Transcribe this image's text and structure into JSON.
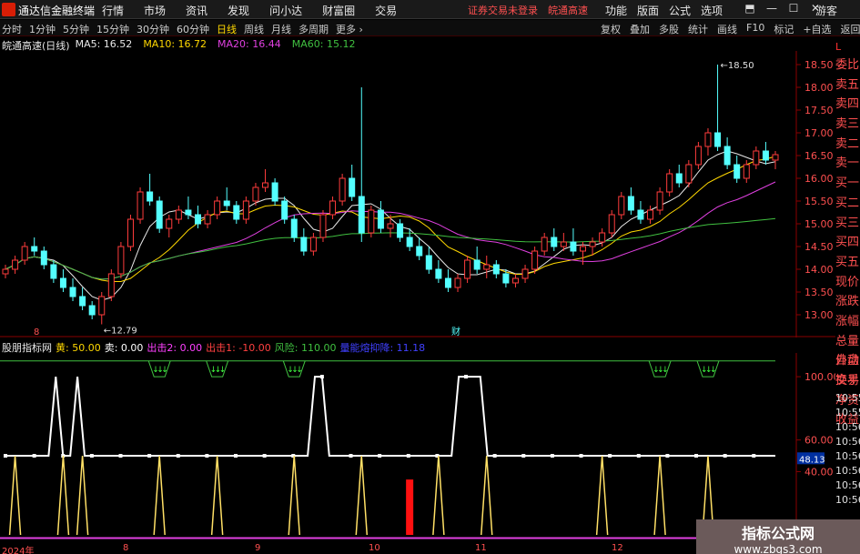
{
  "app": {
    "name": "通达信金融终端",
    "status_text": "证券交易未登录　皖通高速",
    "guest": "游客"
  },
  "menu": [
    "行情",
    "市场",
    "资讯",
    "发现",
    "问小达",
    "财富圈",
    "交易"
  ],
  "right_menu": [
    "功能",
    "版面",
    "公式",
    "选项"
  ],
  "window_buttons": [
    "⬒",
    "—",
    "☐",
    "✕"
  ],
  "periods": [
    "分时",
    "1分钟",
    "5分钟",
    "15分钟",
    "30分钟",
    "60分钟",
    "日线",
    "周线",
    "月线",
    "多周期",
    "更多 ›"
  ],
  "active_period": "日线",
  "tools": [
    "复权",
    "叠加",
    "多股",
    "统计",
    "画线",
    "F10",
    "标记",
    "+自选",
    "返回"
  ],
  "stock": {
    "name": "皖通高速(日线)"
  },
  "ma": [
    {
      "label": "MA5: 16.52",
      "color": "#e8e8e8"
    },
    {
      "label": "MA10: 16.72",
      "color": "#ffd800"
    },
    {
      "label": "MA20: 16.44",
      "color": "#e040e0"
    },
    {
      "label": "MA60: 15.12",
      "color": "#40c040"
    }
  ],
  "price_axis": [
    "18.50",
    "18.00",
    "17.50",
    "17.00",
    "16.50",
    "16.00",
    "15.50",
    "15.00",
    "14.50",
    "14.00",
    "13.50",
    "13.00"
  ],
  "annotations": {
    "high": "18.50",
    "low": "12.79",
    "marker8": "8",
    "marker_fin": "财"
  },
  "sidebar": {
    "header": "L",
    "items": [
      "委比",
      "卖五",
      "卖四",
      "卖三",
      "卖二",
      "卖一",
      "买一",
      "买二",
      "买三",
      "买四",
      "买五",
      "现价",
      "涨跌",
      "涨幅",
      "总量",
      "外盘",
      "换手",
      "净资",
      "收益"
    ]
  },
  "sidebar2": {
    "items": [
      "自动",
      "交易"
    ],
    "times": [
      "10:55",
      "10:55",
      "10:56",
      "10:56",
      "10:56",
      "10:56",
      "10:56",
      "10:56"
    ]
  },
  "indicator": {
    "title": "股朋指标网",
    "values": [
      {
        "label": "黄: 50.00",
        "color": "#ffd800"
      },
      {
        "label": "卖: 0.00",
        "color": "#ffffff"
      },
      {
        "label": "出击2: 0.00",
        "color": "#ff40ff"
      },
      {
        "label": "出击1: -10.00",
        "color": "#ff4040"
      },
      {
        "label": "风险: 110.00",
        "color": "#40c040"
      },
      {
        "label": "量能熔抑降: 11.18",
        "color": "#4040ff"
      }
    ],
    "axis": [
      "100.00",
      "60.00",
      "40.00"
    ],
    "current": "48.13"
  },
  "dates": [
    "2024年",
    "8",
    "9",
    "10",
    "11",
    "12"
  ],
  "watermark": {
    "line1": "指标公式网",
    "line2": "www.zbgs3.com"
  },
  "chart_data": {
    "type": "candlestick",
    "ylim": [
      12.6,
      18.8
    ],
    "candles": [
      [
        13.9,
        14.1,
        13.8,
        14.0
      ],
      [
        14.0,
        14.3,
        13.9,
        14.2
      ],
      [
        14.2,
        14.6,
        14.1,
        14.5
      ],
      [
        14.5,
        14.7,
        14.3,
        14.4
      ],
      [
        14.4,
        14.5,
        14.0,
        14.1
      ],
      [
        14.1,
        14.2,
        13.7,
        13.8
      ],
      [
        13.8,
        14.0,
        13.5,
        13.6
      ],
      [
        13.6,
        13.8,
        13.3,
        13.4
      ],
      [
        13.4,
        13.6,
        13.1,
        13.2
      ],
      [
        13.2,
        13.3,
        12.9,
        13.0
      ],
      [
        13.0,
        13.5,
        12.79,
        13.4
      ],
      [
        13.4,
        14.0,
        13.3,
        13.9
      ],
      [
        13.9,
        14.6,
        13.8,
        14.5
      ],
      [
        14.5,
        15.2,
        14.4,
        15.1
      ],
      [
        15.1,
        15.8,
        15.0,
        15.7
      ],
      [
        15.7,
        16.1,
        15.4,
        15.5
      ],
      [
        15.5,
        15.6,
        14.8,
        14.9
      ],
      [
        14.9,
        15.2,
        14.7,
        15.1
      ],
      [
        15.1,
        15.4,
        15.0,
        15.3
      ],
      [
        15.3,
        15.6,
        15.1,
        15.2
      ],
      [
        15.2,
        15.4,
        14.9,
        15.0
      ],
      [
        15.0,
        15.3,
        14.9,
        15.2
      ],
      [
        15.2,
        15.6,
        15.1,
        15.5
      ],
      [
        15.5,
        15.8,
        15.3,
        15.4
      ],
      [
        15.4,
        15.5,
        15.0,
        15.1
      ],
      [
        15.1,
        15.6,
        15.0,
        15.5
      ],
      [
        15.5,
        15.9,
        15.4,
        15.8
      ],
      [
        15.8,
        16.2,
        15.7,
        15.9
      ],
      [
        15.9,
        16.0,
        15.4,
        15.5
      ],
      [
        15.5,
        15.6,
        15.0,
        15.1
      ],
      [
        15.1,
        15.2,
        14.6,
        14.7
      ],
      [
        14.7,
        14.9,
        14.3,
        14.4
      ],
      [
        14.4,
        14.8,
        14.3,
        14.7
      ],
      [
        14.7,
        15.3,
        14.6,
        15.2
      ],
      [
        15.2,
        15.6,
        15.1,
        15.5
      ],
      [
        15.5,
        16.1,
        15.4,
        16.0
      ],
      [
        16.0,
        16.3,
        15.5,
        15.6
      ],
      [
        15.6,
        18.0,
        14.6,
        14.8
      ],
      [
        14.8,
        15.4,
        14.7,
        15.3
      ],
      [
        15.3,
        15.5,
        14.8,
        14.9
      ],
      [
        14.9,
        15.2,
        14.7,
        15.0
      ],
      [
        15.0,
        15.1,
        14.6,
        14.7
      ],
      [
        14.7,
        14.9,
        14.4,
        14.5
      ],
      [
        14.5,
        14.7,
        14.2,
        14.3
      ],
      [
        14.3,
        14.5,
        13.9,
        14.0
      ],
      [
        14.0,
        14.2,
        13.7,
        13.8
      ],
      [
        13.8,
        14.0,
        13.5,
        13.6
      ],
      [
        13.6,
        13.9,
        13.5,
        13.8
      ],
      [
        13.8,
        14.3,
        13.7,
        14.2
      ],
      [
        14.2,
        14.5,
        13.9,
        14.0
      ],
      [
        14.0,
        14.3,
        13.8,
        14.1
      ],
      [
        14.1,
        14.2,
        13.8,
        13.9
      ],
      [
        13.9,
        14.0,
        13.6,
        13.7
      ],
      [
        13.7,
        13.9,
        13.6,
        13.8
      ],
      [
        13.8,
        14.1,
        13.7,
        14.0
      ],
      [
        14.0,
        14.5,
        13.9,
        14.4
      ],
      [
        14.4,
        14.8,
        14.3,
        14.7
      ],
      [
        14.7,
        14.9,
        14.4,
        14.5
      ],
      [
        14.5,
        14.8,
        14.4,
        14.6
      ],
      [
        14.6,
        14.9,
        14.3,
        14.4
      ],
      [
        14.4,
        14.6,
        14.1,
        14.5
      ],
      [
        14.5,
        14.7,
        14.3,
        14.6
      ],
      [
        14.6,
        14.9,
        14.5,
        14.8
      ],
      [
        14.8,
        15.3,
        14.7,
        15.2
      ],
      [
        15.2,
        15.7,
        15.1,
        15.6
      ],
      [
        15.6,
        15.8,
        15.2,
        15.3
      ],
      [
        15.3,
        15.5,
        15.0,
        15.1
      ],
      [
        15.1,
        15.4,
        15.0,
        15.3
      ],
      [
        15.3,
        15.8,
        15.2,
        15.7
      ],
      [
        15.7,
        16.2,
        15.6,
        16.1
      ],
      [
        16.1,
        16.3,
        15.8,
        15.9
      ],
      [
        15.9,
        16.4,
        15.8,
        16.3
      ],
      [
        16.3,
        16.8,
        16.2,
        16.7
      ],
      [
        16.7,
        17.1,
        16.5,
        17.0
      ],
      [
        17.0,
        18.5,
        16.6,
        16.7
      ],
      [
        16.7,
        16.9,
        16.2,
        16.3
      ],
      [
        16.3,
        16.5,
        15.9,
        16.0
      ],
      [
        16.0,
        16.4,
        15.9,
        16.3
      ],
      [
        16.3,
        16.7,
        16.2,
        16.6
      ],
      [
        16.6,
        16.8,
        16.3,
        16.4
      ],
      [
        16.4,
        16.6,
        16.2,
        16.52
      ]
    ],
    "ma5_color": "#e8e8e8",
    "ma10_color": "#ffd800",
    "ma20_color": "#e040e0",
    "ma60_color": "#40c040",
    "indicator_ylim": [
      0,
      115
    ],
    "white_line": [
      50,
      50,
      50,
      50,
      50,
      50,
      50,
      100,
      50,
      50,
      100,
      50,
      50,
      50,
      50,
      50,
      50,
      50,
      50,
      50,
      50,
      50,
      50,
      50,
      50,
      50,
      50,
      50,
      50,
      50,
      50,
      50,
      50,
      50,
      50,
      50,
      50,
      50,
      50,
      50,
      50,
      50,
      50,
      100,
      100,
      50,
      50,
      50,
      50,
      50,
      50,
      50,
      50,
      50,
      50,
      50,
      50,
      50,
      50,
      50,
      50,
      50,
      50,
      100,
      100,
      100,
      100,
      50,
      50,
      50,
      50,
      50,
      50,
      50,
      50,
      50,
      50,
      50,
      50,
      50,
      50,
      50,
      50,
      50,
      50,
      50,
      50,
      50,
      50,
      50,
      50,
      50,
      50,
      50,
      50,
      50,
      50,
      50,
      50,
      50,
      50,
      50,
      50,
      50,
      50,
      50,
      50,
      50
    ],
    "yellow_spikes": [
      1,
      6,
      8,
      16,
      22,
      30,
      37,
      45,
      50,
      62,
      68,
      73
    ],
    "red_bar_index": 42,
    "signal_index": [
      16,
      22,
      30,
      68,
      73
    ]
  }
}
